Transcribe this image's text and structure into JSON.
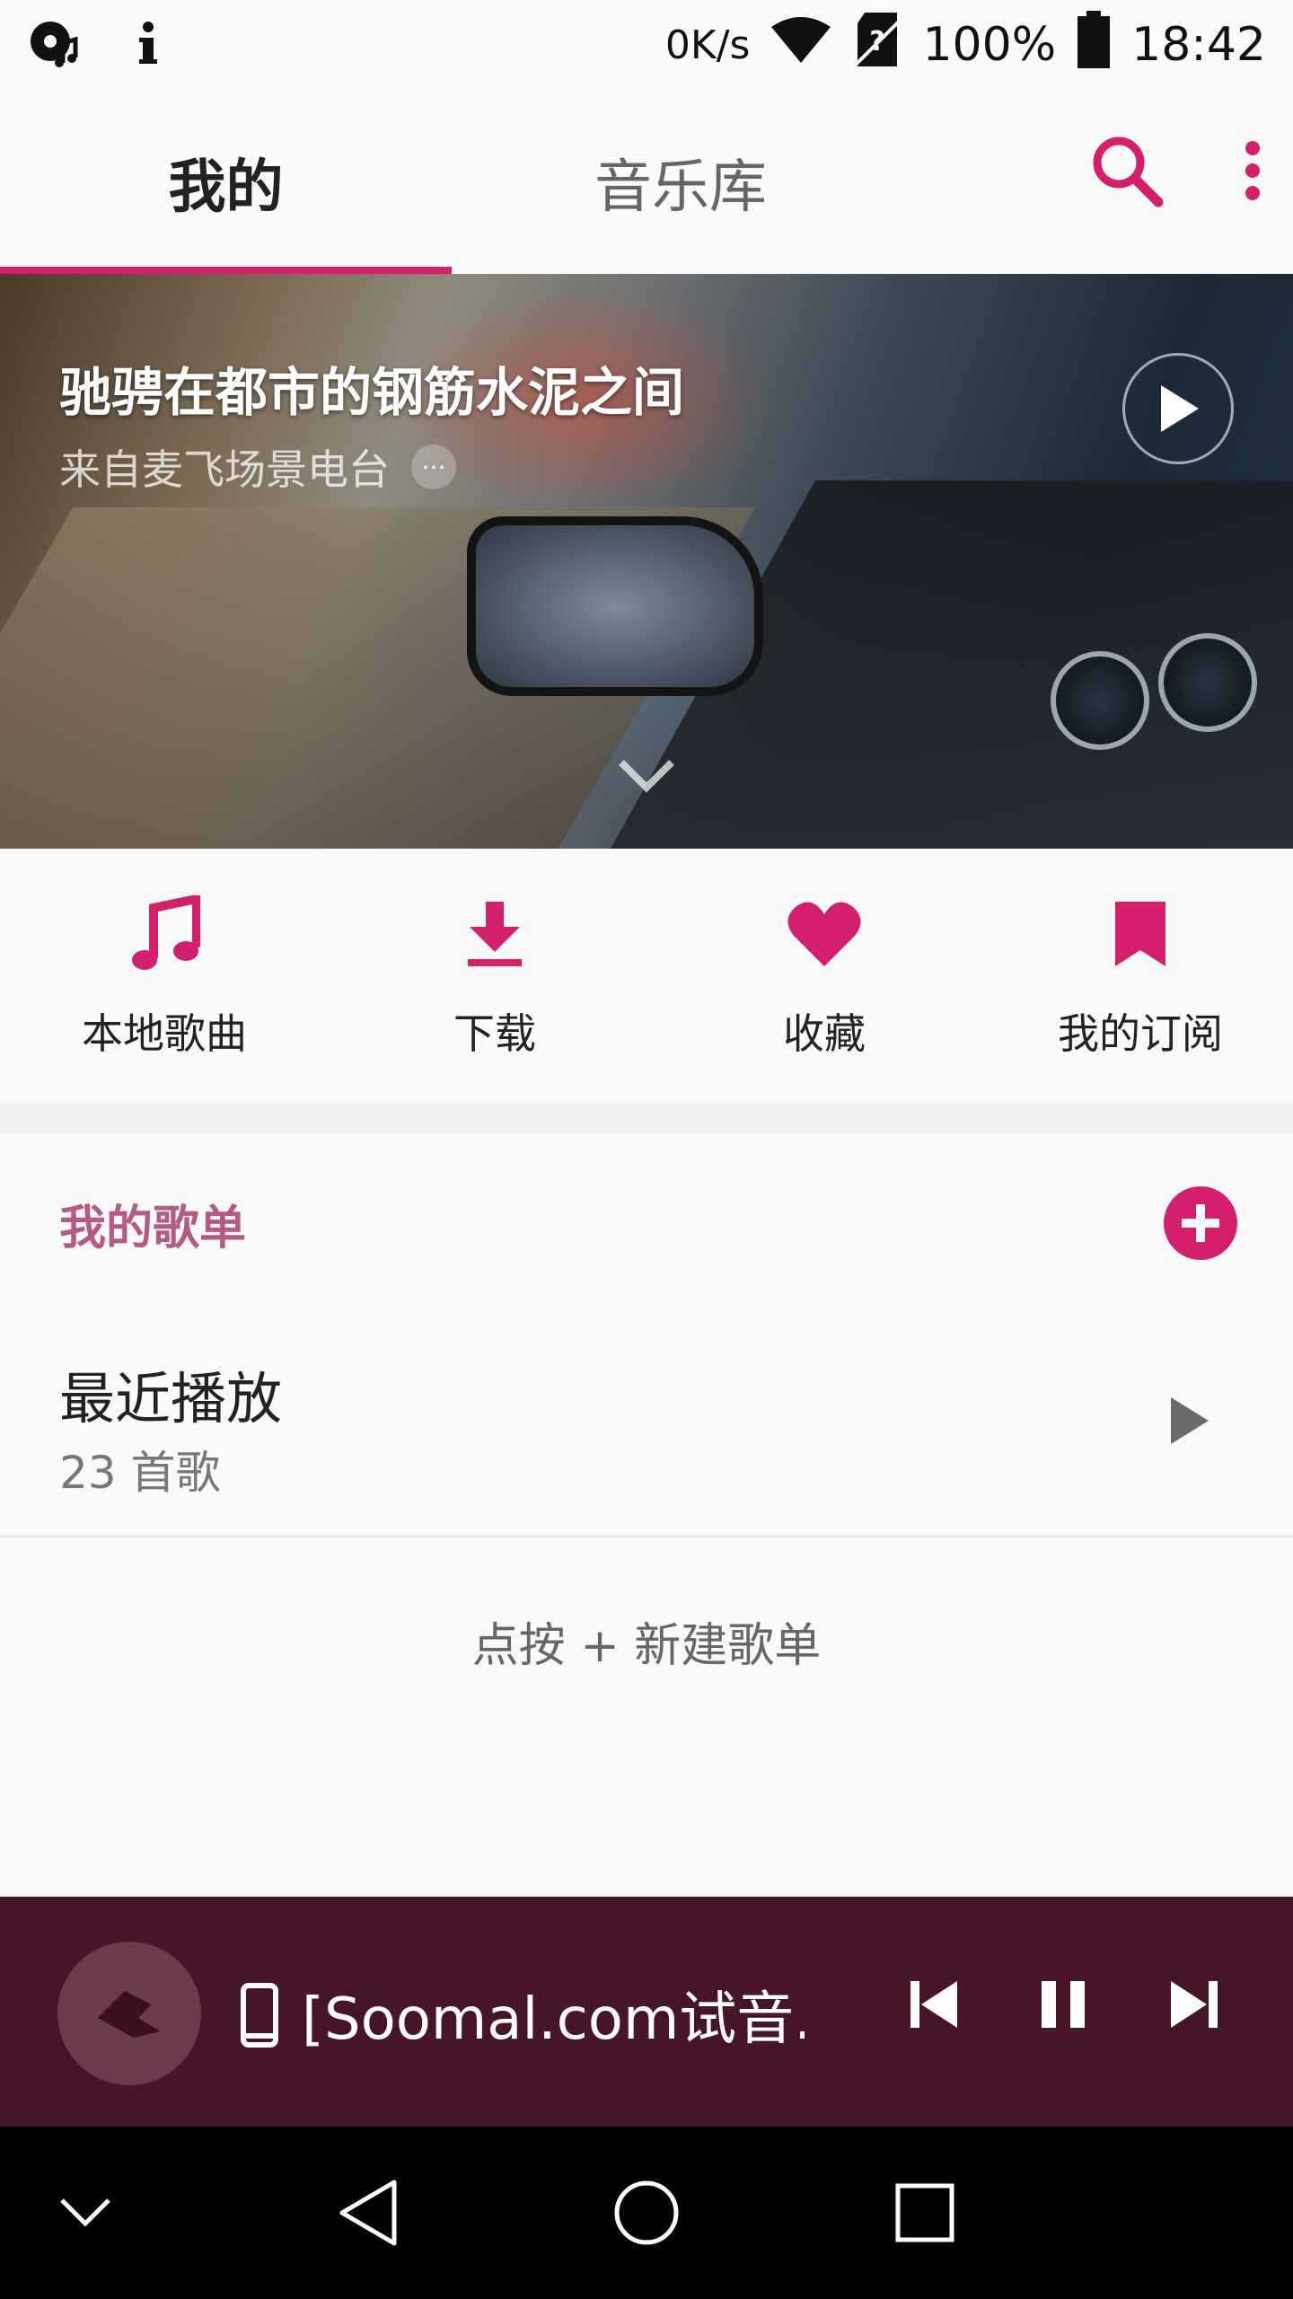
{
  "status_bar": {
    "speed": "0K/s",
    "battery": "100%",
    "time": "18:42",
    "icons": [
      "music-notification-icon",
      "info-icon",
      "wifi-icon",
      "sim-unknown-icon",
      "battery-icon"
    ]
  },
  "tabs": [
    {
      "label": "我的",
      "active": true
    },
    {
      "label": "音乐库",
      "active": false
    }
  ],
  "accent_color": "#d41f6c",
  "banner": {
    "title": "驰骋在都市的钢筋水泥之间",
    "subtitle": "来自麦飞场景电台",
    "more_label": "···"
  },
  "quick_actions": [
    {
      "label": "本地歌曲",
      "icon": "music-note-icon"
    },
    {
      "label": "下载",
      "icon": "download-icon"
    },
    {
      "label": "收藏",
      "icon": "heart-icon"
    },
    {
      "label": "我的订阅",
      "icon": "bookmark-icon"
    }
  ],
  "playlists": {
    "header": "我的歌单",
    "items": [
      {
        "name": "最近播放",
        "count": "23 首歌"
      }
    ],
    "hint": "点按 + 新建歌单"
  },
  "player": {
    "title": "[Soomal.com试音...",
    "background": "#46152a"
  },
  "navbar": {
    "icons": [
      "collapse-icon",
      "back-icon",
      "home-icon",
      "recents-icon"
    ]
  }
}
